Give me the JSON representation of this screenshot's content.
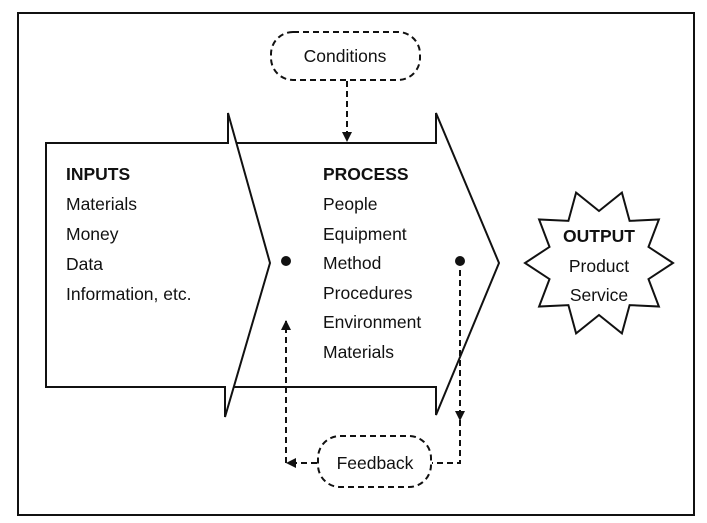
{
  "conditions": {
    "label": "Conditions"
  },
  "inputs": {
    "title": "INPUTS",
    "items": [
      "Materials",
      "Money",
      "Data",
      "Information, etc."
    ]
  },
  "process": {
    "title": "PROCESS",
    "items": [
      "People",
      "Equipment",
      "Method",
      "Procedures",
      "Environment",
      "Materials"
    ]
  },
  "output": {
    "title": "OUTPUT",
    "items": [
      "Product",
      "Service"
    ]
  },
  "feedback": {
    "label": "Feedback"
  }
}
